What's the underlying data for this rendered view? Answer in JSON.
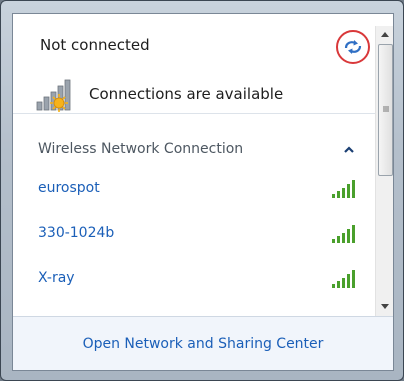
{
  "header": {
    "status": "Not connected",
    "connections_text": "Connections are available"
  },
  "section": {
    "title": "Wireless Network Connection"
  },
  "networks": [
    {
      "name": "eurospot",
      "signal_bars": 5
    },
    {
      "name": "330-1024b",
      "signal_bars": 5
    },
    {
      "name": "X-ray",
      "signal_bars": 5
    }
  ],
  "footer": {
    "link": "Open Network and Sharing Center"
  },
  "colors": {
    "link": "#1b5fb8",
    "signal_green": "#4aa02c",
    "highlight_circle": "#d9383a",
    "refresh_blue": "#2f6fc4"
  },
  "icons": {
    "refresh": "refresh-icon",
    "network_status": "network-available-icon",
    "collapse": "chevron-up-icon",
    "signal": "signal-strength-icon"
  }
}
